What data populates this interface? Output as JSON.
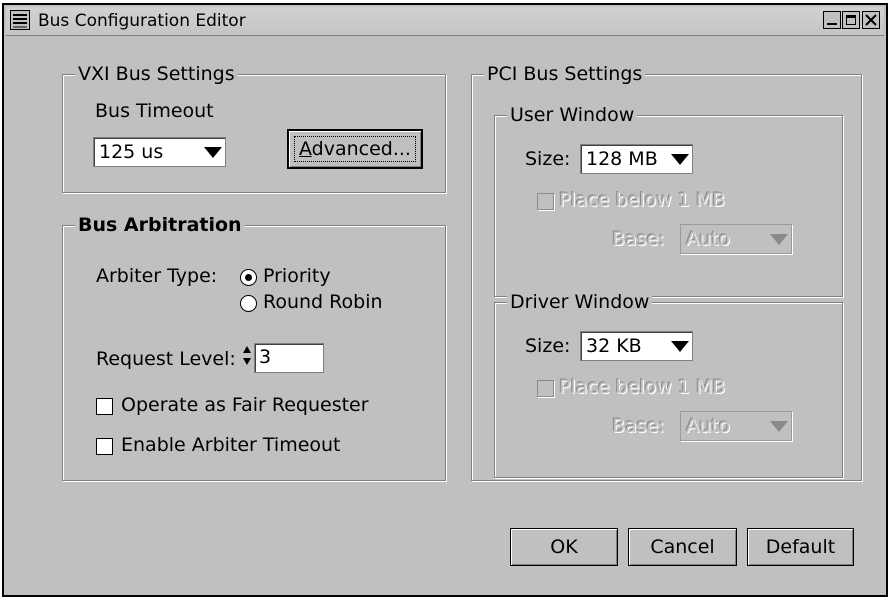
{
  "window": {
    "title": "Bus Configuration Editor"
  },
  "vxi": {
    "group_title": "VXI Bus Settings",
    "timeout_label": "Bus Timeout",
    "timeout_value": "125 us",
    "advanced_label_first": "A",
    "advanced_label_rest": "dvanced..."
  },
  "arbitration": {
    "group_title": "Bus Arbitration",
    "arbiter_type_label": "Arbiter Type:",
    "priority_label": "Priority",
    "round_robin_label": "Round Robin",
    "selected": "Priority",
    "request_level_label": "Request Level:",
    "request_level_value": "3",
    "fair_requester_label": "Operate as Fair Requester",
    "fair_requester_checked": false,
    "arbiter_timeout_label": "Enable Arbiter Timeout",
    "arbiter_timeout_checked": false
  },
  "pci": {
    "group_title": "PCI Bus Settings",
    "user_window": {
      "title": "User Window",
      "size_label": "Size:",
      "size_value": "128 MB",
      "place_below_label": "Place below 1 MB",
      "base_label": "Base:",
      "base_value": "Auto"
    },
    "driver_window": {
      "title": "Driver Window",
      "size_label": "Size:",
      "size_value": "32 KB",
      "place_below_label": "Place below 1 MB",
      "base_label": "Base:",
      "base_value": "Auto"
    }
  },
  "buttons": {
    "ok": "OK",
    "cancel": "Cancel",
    "default": "Default"
  },
  "colors": {
    "face": "#c0c0c0",
    "shadow": "#808080",
    "highlight": "#ffffff",
    "disabled_text": "#8a8a8a"
  }
}
